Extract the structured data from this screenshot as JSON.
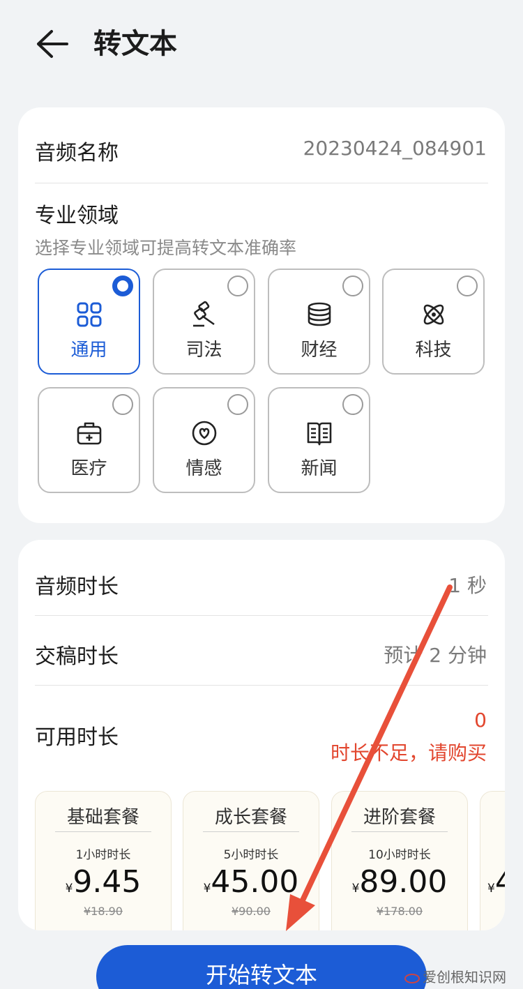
{
  "header": {
    "title": "转文本"
  },
  "audio_name": {
    "label": "音频名称",
    "value": "20230424_084901"
  },
  "domain_section": {
    "title": "专业领域",
    "subtitle": "选择专业领域可提高转文本准确率",
    "selected": "通用",
    "options": [
      {
        "label": "通用",
        "icon": "grid-icon"
      },
      {
        "label": "司法",
        "icon": "gavel-icon"
      },
      {
        "label": "财经",
        "icon": "coins-icon"
      },
      {
        "label": "科技",
        "icon": "atom-icon"
      },
      {
        "label": "医疗",
        "icon": "medical-kit-icon"
      },
      {
        "label": "情感",
        "icon": "heart-icon"
      },
      {
        "label": "新闻",
        "icon": "book-icon"
      }
    ]
  },
  "durations": {
    "audio": {
      "label": "音频时长",
      "value": "1 秒"
    },
    "delivery": {
      "label": "交稿时长",
      "value": "预计 2 分钟"
    },
    "available": {
      "label": "可用时长",
      "value": "0",
      "warning": "时长不足，请购买"
    }
  },
  "packages": [
    {
      "name": "基础套餐",
      "duration": "1小时时长",
      "currency": "¥",
      "price": "9.45",
      "original": "¥18.90"
    },
    {
      "name": "成长套餐",
      "duration": "5小时时长",
      "currency": "¥",
      "price": "45.00",
      "original": "¥90.00"
    },
    {
      "name": "进阶套餐",
      "duration": "10小时时长",
      "currency": "¥",
      "price": "89.00",
      "original": "¥178.00"
    },
    {
      "name": "",
      "duration": "",
      "currency": "¥",
      "price": "4",
      "original": ""
    }
  ],
  "start_button": {
    "label": "开始转文本"
  },
  "watermark": {
    "text": "爱创根知识网"
  },
  "colors": {
    "accent": "#1c5cd6",
    "warning": "#e2462e",
    "annotation_arrow": "#e8503a"
  }
}
